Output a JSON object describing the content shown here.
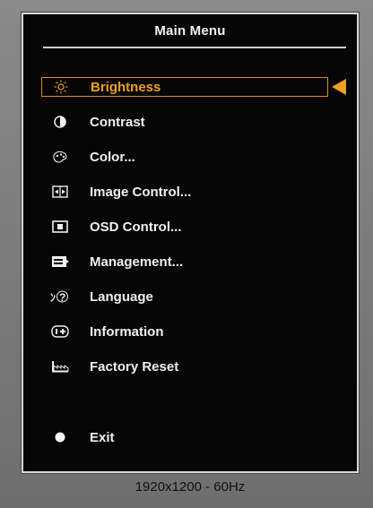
{
  "menu": {
    "title": "Main Menu",
    "items": [
      {
        "label": "Brightness",
        "icon": "sun-icon",
        "selected": true
      },
      {
        "label": "Contrast",
        "icon": "contrast-icon"
      },
      {
        "label": "Color...",
        "icon": "palette-icon"
      },
      {
        "label": "Image Control...",
        "icon": "image-control-icon"
      },
      {
        "label": "OSD Control...",
        "icon": "osd-icon"
      },
      {
        "label": "Management...",
        "icon": "management-icon"
      },
      {
        "label": "Language",
        "icon": "language-icon"
      },
      {
        "label": "Information",
        "icon": "information-icon"
      },
      {
        "label": "Factory Reset",
        "icon": "factory-reset-icon"
      }
    ],
    "exit": {
      "label": "Exit",
      "icon": "exit-icon"
    }
  },
  "status": {
    "resolution": "1920x1200 - 60Hz"
  },
  "colors": {
    "accent": "#f0a020",
    "background": "#060606",
    "text": "#f0f0f0"
  }
}
